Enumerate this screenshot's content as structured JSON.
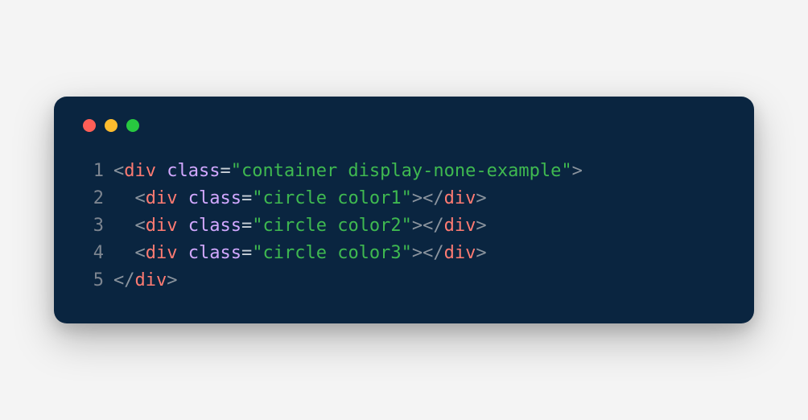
{
  "window": {
    "traffic_lights": {
      "red": "#ff5f57",
      "yellow": "#febc2e",
      "green": "#28c840"
    }
  },
  "code": {
    "lines": [
      {
        "n": "1",
        "tokens": [
          {
            "c": "bracket",
            "t": "<"
          },
          {
            "c": "tag",
            "t": "div"
          },
          {
            "c": "plain",
            "t": " "
          },
          {
            "c": "attr",
            "t": "class"
          },
          {
            "c": "eq",
            "t": "="
          },
          {
            "c": "string",
            "t": "\"container display-none-example\""
          },
          {
            "c": "bracket",
            "t": ">"
          }
        ]
      },
      {
        "n": "2",
        "tokens": [
          {
            "c": "plain",
            "t": "  "
          },
          {
            "c": "bracket",
            "t": "<"
          },
          {
            "c": "tag",
            "t": "div"
          },
          {
            "c": "plain",
            "t": " "
          },
          {
            "c": "attr",
            "t": "class"
          },
          {
            "c": "eq",
            "t": "="
          },
          {
            "c": "string",
            "t": "\"circle color1\""
          },
          {
            "c": "bracket",
            "t": ">"
          },
          {
            "c": "bracket",
            "t": "</"
          },
          {
            "c": "tag",
            "t": "div"
          },
          {
            "c": "bracket",
            "t": ">"
          }
        ]
      },
      {
        "n": "3",
        "tokens": [
          {
            "c": "plain",
            "t": "  "
          },
          {
            "c": "bracket",
            "t": "<"
          },
          {
            "c": "tag",
            "t": "div"
          },
          {
            "c": "plain",
            "t": " "
          },
          {
            "c": "attr",
            "t": "class"
          },
          {
            "c": "eq",
            "t": "="
          },
          {
            "c": "string",
            "t": "\"circle color2\""
          },
          {
            "c": "bracket",
            "t": ">"
          },
          {
            "c": "bracket",
            "t": "</"
          },
          {
            "c": "tag",
            "t": "div"
          },
          {
            "c": "bracket",
            "t": ">"
          }
        ]
      },
      {
        "n": "4",
        "tokens": [
          {
            "c": "plain",
            "t": "  "
          },
          {
            "c": "bracket",
            "t": "<"
          },
          {
            "c": "tag",
            "t": "div"
          },
          {
            "c": "plain",
            "t": " "
          },
          {
            "c": "attr",
            "t": "class"
          },
          {
            "c": "eq",
            "t": "="
          },
          {
            "c": "string",
            "t": "\"circle color3\""
          },
          {
            "c": "bracket",
            "t": ">"
          },
          {
            "c": "bracket",
            "t": "</"
          },
          {
            "c": "tag",
            "t": "div"
          },
          {
            "c": "bracket",
            "t": ">"
          }
        ]
      },
      {
        "n": "5",
        "tokens": [
          {
            "c": "bracket",
            "t": "</"
          },
          {
            "c": "tag",
            "t": "div"
          },
          {
            "c": "bracket",
            "t": ">"
          }
        ]
      }
    ]
  }
}
